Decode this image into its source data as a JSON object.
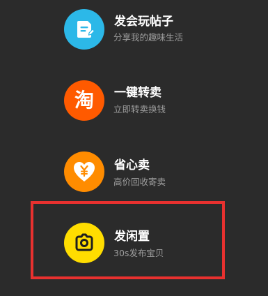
{
  "menu": {
    "items": [
      {
        "title": "发会玩帖子",
        "subtitle": "分享我的趣味生活",
        "icon": "post-note-icon",
        "color": "#2cb8e8"
      },
      {
        "title": "一键转卖",
        "subtitle": "立即转卖换钱",
        "icon": "taobao-icon",
        "icon_text": "淘",
        "color": "#ff5a00"
      },
      {
        "title": "省心卖",
        "subtitle": "高价回收寄卖",
        "icon": "yuan-heart-icon",
        "color": "#ff8c00"
      },
      {
        "title": "发闲置",
        "subtitle": "30s发布宝贝",
        "icon": "camera-icon",
        "color": "#ffdd00",
        "highlighted": true
      }
    ]
  },
  "highlight_color": "#e8312f"
}
